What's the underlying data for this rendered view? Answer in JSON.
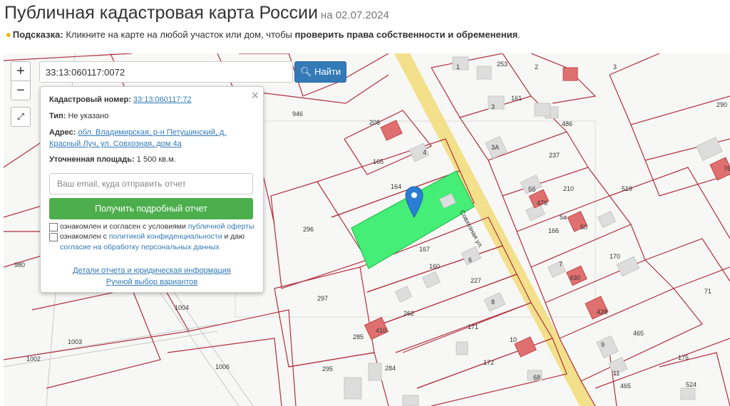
{
  "header": {
    "title": "Публичная кадастровая карта России",
    "date": "на 02.07.2024"
  },
  "hint": {
    "label": "Подсказка:",
    "text": " Кликните на карте на любой участок или дом, чтобы ",
    "bold": "проверить права собственности и обременения",
    "end": "."
  },
  "map_controls": {
    "zoom_in": "+",
    "zoom_out": "−",
    "fullscreen": "⤢"
  },
  "search": {
    "value": "33:13:060117:0072",
    "button_label": "Найти",
    "button_icon": "search-icon"
  },
  "popup": {
    "close": "×",
    "cadastral_label": "Кадастровый номер:",
    "cadastral_value": "33:13:060117:72",
    "type_label": "Тип:",
    "type_value": "Не указано",
    "address_label": "Адрес:",
    "address_line1": "обл. Владимирская, р-н Петушинский, д.",
    "address_line2": "Красный Луч, ул. Совхозная, дом 4а",
    "area_label": "Уточненная площадь:",
    "area_value": "1 500 кв.м.",
    "email_placeholder": "Ваш email, куда отправить отчет",
    "report_button": "Получить подробный отчет",
    "consent1_text": "ознакомлен и согласен с условиями ",
    "consent1_link": "публичной оферты",
    "consent2_text": "ознакомлен с ",
    "consent2_link": "политикой конфиденциальности",
    "consent2_tail": " и даю",
    "consent2_link2": "согласие на обработку персональных данных",
    "details_link": "Детали отчета и юридическая информация",
    "manual_link": "Ручной выбор вариантов"
  },
  "map": {
    "street_label": "Совхозная ул.",
    "colors": {
      "parcel_line": "#b03040",
      "selected_parcel": "#44ee77",
      "road": "#f3e08a",
      "building_red": "#e07070",
      "building_grey": "#dddddd",
      "marker": "#2a7fd4"
    },
    "parcel_numbers": [
      "946",
      "208",
      "165",
      "164",
      "296",
      "167",
      "160",
      "297",
      "262",
      "980",
      "1004",
      "1003",
      "1002",
      "1006",
      "295",
      "285",
      "284",
      "171",
      "227",
      "8",
      "6",
      "172",
      "68",
      "10",
      "9",
      "11",
      "175",
      "524",
      "71",
      "465",
      "170",
      "519",
      "210",
      "237",
      "161",
      "253",
      "1",
      "3",
      "3А",
      "486",
      "290",
      "761",
      "5б",
      "476",
      "5а",
      "166",
      "7",
      "430",
      "50",
      "4",
      "428",
      "410",
      "2",
      "3",
      "465"
    ],
    "building_labels": [
      "510",
      "476",
      "430",
      "437",
      "428",
      "516",
      "508",
      "60",
      "477",
      "761"
    ]
  }
}
